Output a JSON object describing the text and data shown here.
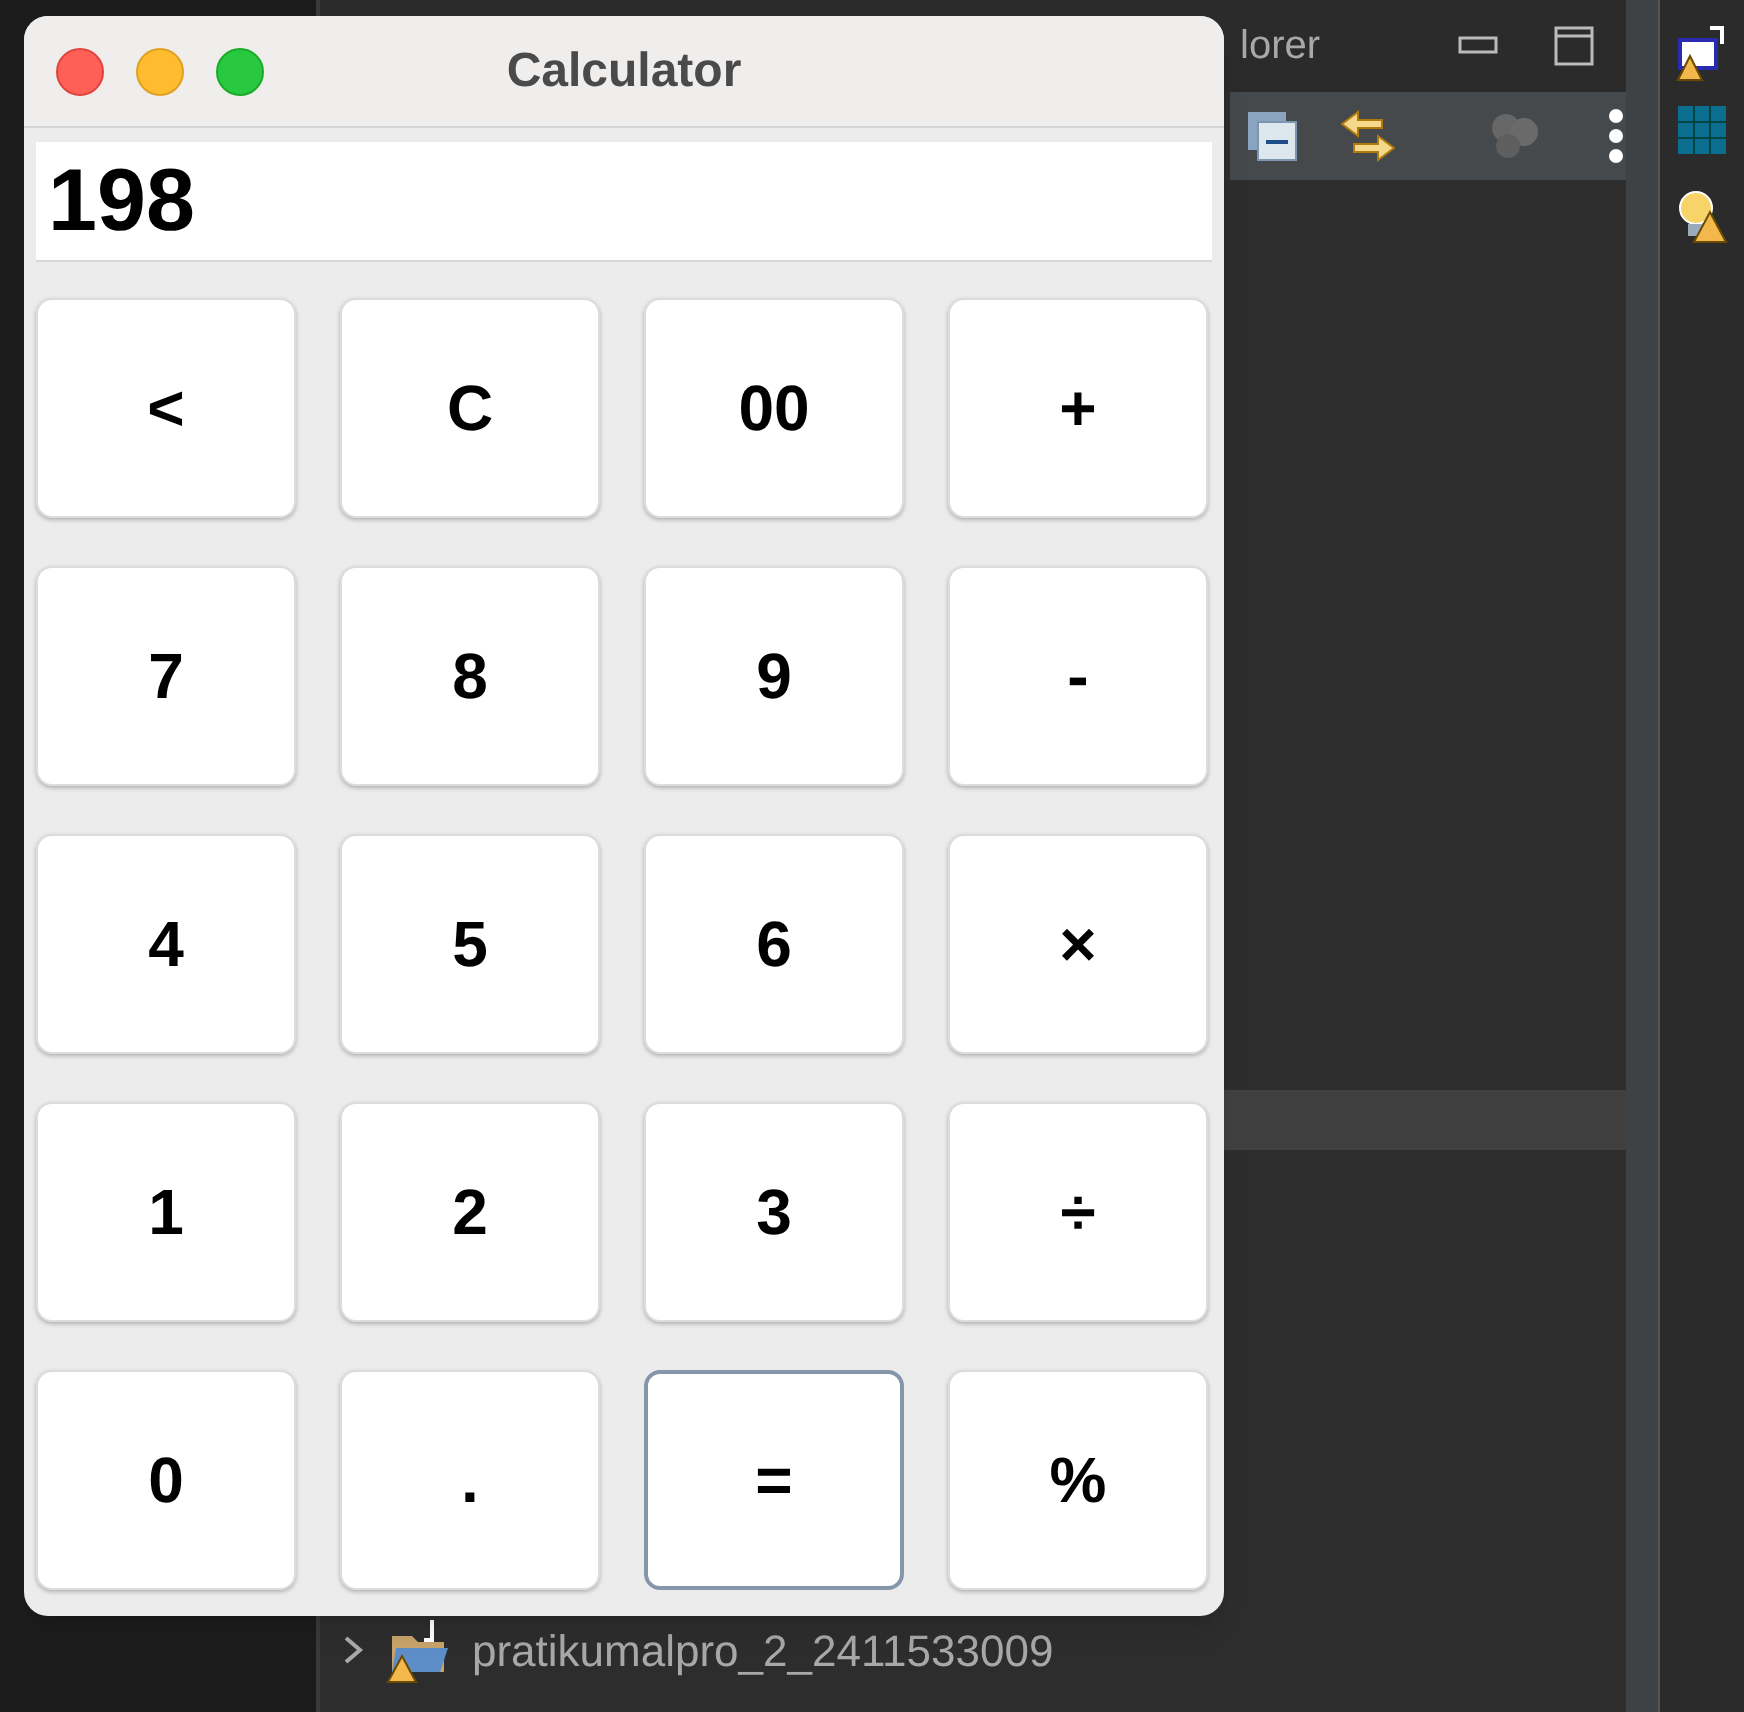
{
  "ide": {
    "panel_tab": "lorer",
    "tree_items": [
      {
        "label": "pratikumalpro_2_2411533009",
        "expanded": false
      }
    ]
  },
  "calculator": {
    "title": "Calculator",
    "display": "198",
    "keys": [
      {
        "label": "<",
        "focused": false
      },
      {
        "label": "C",
        "focused": false
      },
      {
        "label": "00",
        "focused": false
      },
      {
        "label": "+",
        "focused": false
      },
      {
        "label": "7",
        "focused": false
      },
      {
        "label": "8",
        "focused": false
      },
      {
        "label": "9",
        "focused": false
      },
      {
        "label": "-",
        "focused": false
      },
      {
        "label": "4",
        "focused": false
      },
      {
        "label": "5",
        "focused": false
      },
      {
        "label": "6",
        "focused": false
      },
      {
        "label": "×",
        "focused": false
      },
      {
        "label": "1",
        "focused": false
      },
      {
        "label": "2",
        "focused": false
      },
      {
        "label": "3",
        "focused": false
      },
      {
        "label": "÷",
        "focused": false
      },
      {
        "label": "0",
        "focused": false
      },
      {
        "label": ".",
        "focused": false
      },
      {
        "label": "=",
        "focused": true
      },
      {
        "label": "%",
        "focused": false
      }
    ]
  }
}
